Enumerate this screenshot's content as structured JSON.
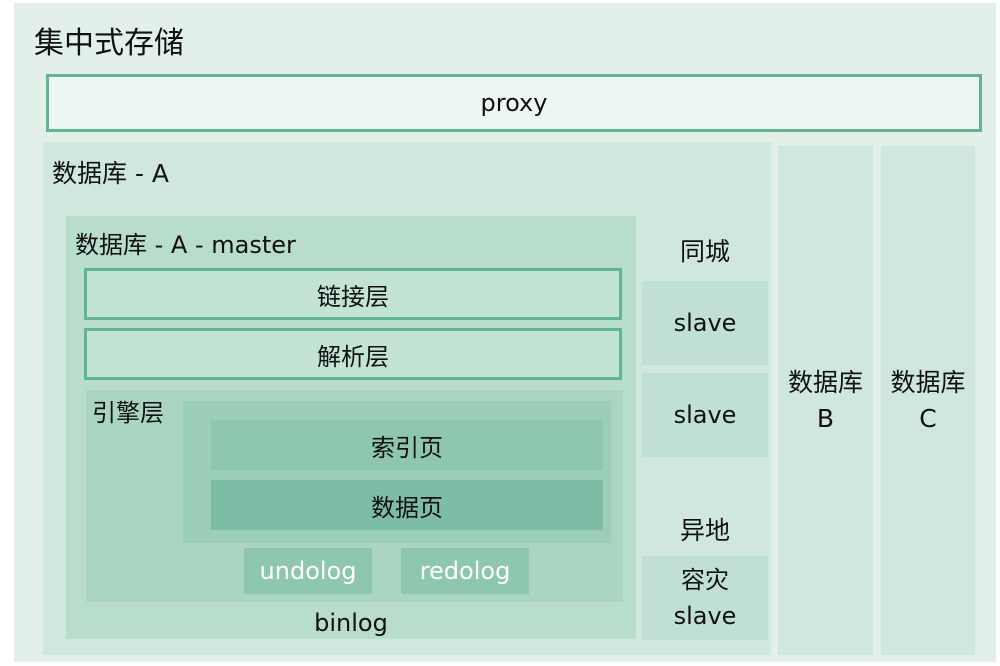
{
  "title": "集中式存储",
  "proxy": "proxy",
  "db_a": {
    "label": "数据库 - A",
    "master": {
      "label": "数据库 - A - master",
      "layers": [
        "链接层",
        "解析层"
      ],
      "engine": {
        "label": "引擎层",
        "pages": [
          "索引页",
          "数据页"
        ],
        "logs": [
          "undolog",
          "redolog"
        ]
      },
      "binlog": "binlog"
    },
    "same_city": {
      "label": "同城",
      "slaves": [
        "slave",
        "slave"
      ]
    },
    "remote": {
      "label": "异地",
      "slave_line1": "容灾",
      "slave_line2": "slave"
    }
  },
  "db_b": {
    "line1": "数据库",
    "line2": "B"
  },
  "db_c": {
    "line1": "数据库",
    "line2": "C"
  }
}
